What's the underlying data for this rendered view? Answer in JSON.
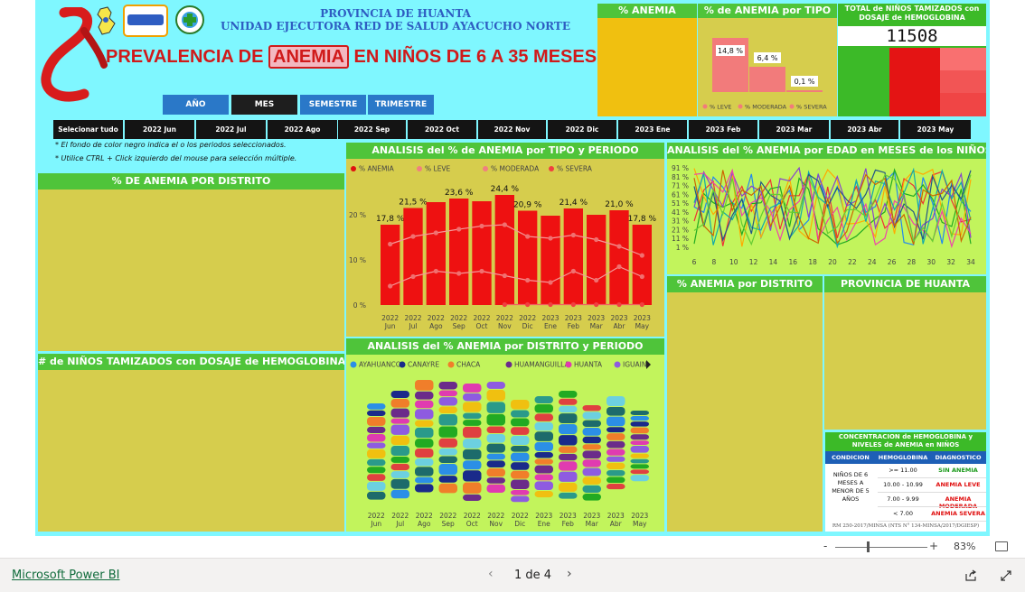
{
  "header": {
    "line1": "PROVINCIA DE HUANTA",
    "line2": "UNIDAD EJECUTORA RED DE SALUD AYACUCHO NORTE",
    "title_pre": "PREVALENCIA DE ",
    "title_box": "ANEMIA",
    "title_post": " EN NIÑOS DE 6 A 35 MESES"
  },
  "period_buttons": [
    "AÑO",
    "MES",
    "SEMESTRE",
    "TRIMESTRE"
  ],
  "slicer": [
    "Selecionar tudo",
    "2022 Jun",
    "2022 Jul",
    "2022 Ago",
    "2022 Sep",
    "2022 Oct",
    "2022 Nov",
    "2022 Dic",
    "2023 Ene",
    "2023 Feb",
    "2023 Mar",
    "2023 Abr",
    "2023 May"
  ],
  "notes": {
    "note1": "* El fondo de color negro indica el o los periodos seleccionados.",
    "note2": "* Utilice CTRL + Click izquierdo del mouse para selección múltiple."
  },
  "kpi": {
    "anemia_title": "% ANEMIA",
    "tipo_title": "% de ANEMIA por TIPO",
    "tipo_values": [
      "14,8 %",
      "6,4 %",
      "0,1 %"
    ],
    "tipo_legend": [
      "% LEVE",
      "% MODERADA",
      "% SEVERA"
    ],
    "total_title": "TOTAL de NIÑOS TAMIZADOS con DOSAJE de HEMOGLOBINA",
    "total_value": "11508"
  },
  "panels": {
    "distrito": "% DE ANEMIA POR DISTRITO",
    "tamizados": "# de NIÑOS TAMIZADOS con DOSAJE de HEMOGLOBINA",
    "tipo_periodo": "ANALISIS del % de ANEMIA por TIPO y PERIODO",
    "edad": "ANALISIS del % ANEMIA por EDAD en MESES de los NIÑOS",
    "distrito_periodo": "ANALISIS del % ANEMIA por DISTRITO y PERIODO",
    "pct_distrito": "% ANEMIA por DISTRITO",
    "provincia": "PROVINCIA DE HUANTA",
    "concentracion": "CONCENTRACION de HEMOGLOBINA y NIVELES de ANEMIA en NIÑOS"
  },
  "hb_table": {
    "headers": [
      "CONDICION",
      "HEMOGLOBINA",
      "DIAGNOSTICO"
    ],
    "condition": "NIÑOS DE 6 MESES A MENOR DE 5 AÑOS",
    "rows": [
      {
        "hb": ">= 11.00",
        "dx": "SIN ANEMIA",
        "color": "#1a9a1a"
      },
      {
        "hb": "10.00 - 10.99",
        "dx": "ANEMIA LEVE",
        "color": "#e01010"
      },
      {
        "hb": "7.00 - 9.99",
        "dx": "ANEMIA MODERADA",
        "color": "#e01010"
      },
      {
        "hb": "< 7.00",
        "dx": "ANEMIA SEVERA",
        "color": "#e01010"
      }
    ],
    "footer": "RM 250-2017/MINSA (NTS N° 134-MINSA/2017/DGIESP)"
  },
  "chart_data": [
    {
      "type": "bar",
      "title": "ANALISIS del % de ANEMIA por TIPO y PERIODO",
      "categories": [
        "2022 Jun",
        "2022 Jul",
        "2022 Ago",
        "2022 Sep",
        "2022 Oct",
        "2022 Nov",
        "2022 Dic",
        "2023 Ene",
        "2023 Feb",
        "2023 Mar",
        "2023 Abr",
        "2023 May"
      ],
      "legend": [
        "% ANEMIA",
        "% LEVE",
        "% MODERADA",
        "% SEVERA"
      ],
      "yticks": [
        "0 %",
        "10 %",
        "20 %"
      ],
      "ylim": [
        0,
        28
      ],
      "series": [
        {
          "name": "% ANEMIA",
          "kind": "bar",
          "color": "#ee1111",
          "values": [
            17.8,
            21.5,
            22.8,
            23.6,
            23.0,
            24.4,
            20.9,
            19.8,
            21.4,
            20.0,
            21.0,
            17.8
          ],
          "labels": [
            "17,8 %",
            "21,5 %",
            "",
            "23,6 %",
            "",
            "24,4 %",
            "20,9 %",
            "",
            "21,4 %",
            "",
            "21,0 %",
            "17,8 %"
          ]
        },
        {
          "name": "% LEVE",
          "kind": "line",
          "color": "#f08080",
          "values": [
            13.5,
            15.2,
            16.0,
            16.8,
            17.5,
            17.8,
            15.2,
            14.8,
            15.5,
            14.5,
            13.0,
            11.0
          ]
        },
        {
          "name": "% MODERADA",
          "kind": "line",
          "color": "#f08080",
          "values": [
            4.2,
            6.3,
            7.5,
            7.0,
            7.5,
            6.5,
            5.5,
            5.0,
            7.5,
            5.5,
            8.5,
            6.3
          ]
        },
        {
          "name": "% SEVERA",
          "kind": "line",
          "color": "#f04040",
          "values": [
            null,
            null,
            null,
            null,
            null,
            0.1,
            0.1,
            0.1,
            0.1,
            0.1,
            0.1,
            0.1
          ]
        }
      ]
    },
    {
      "type": "line",
      "title": "ANALISIS del % ANEMIA por EDAD en MESES de los NIÑOS",
      "x_ticks": [
        6,
        8,
        10,
        12,
        14,
        16,
        18,
        20,
        22,
        24,
        26,
        28,
        30,
        32,
        34
      ],
      "yticks": [
        "1 %",
        "11 %",
        "21 %",
        "31 %",
        "41 %",
        "51 %",
        "61 %",
        "71 %",
        "81 %",
        "91 %"
      ],
      "ylim": [
        1,
        91
      ],
      "series_colors": [
        "#2288ee",
        "#ee3333",
        "#22aa22",
        "#ffaa00",
        "#8844cc",
        "#ee44aa",
        "#11aaaa",
        "#225588",
        "#cc6600",
        "#66cc33"
      ],
      "note": "many overlapping district series"
    },
    {
      "type": "area",
      "title": "ANALISIS del % ANEMIA por DISTRITO y PERIODO",
      "categories": [
        "2022 Jun",
        "2022 Jul",
        "2022 Ago",
        "2022 Sep",
        "2022 Oct",
        "2022 Nov",
        "2022 Dic",
        "2023 Ene",
        "2023 Feb",
        "2023 Mar",
        "2023 Abr",
        "2023 May"
      ],
      "legend": [
        {
          "name": "AYAHUANCO",
          "color": "#2b8fe6"
        },
        {
          "name": "CANAYRE",
          "color": "#1a2a8a"
        },
        {
          "name": "CHACA",
          "color": "#f07e2a"
        },
        {
          "name": "HUAMANGUILLA",
          "color": "#6b2b8a"
        },
        {
          "name": "HUANTA",
          "color": "#e03bb0"
        },
        {
          "name": "IGUAIN",
          "color": "#8e5be0"
        }
      ]
    }
  ],
  "statusbar": {
    "zoom": "83%",
    "minus": "-",
    "plus": "+",
    "brand": "Microsoft Power BI",
    "pager": "1 de 4"
  }
}
